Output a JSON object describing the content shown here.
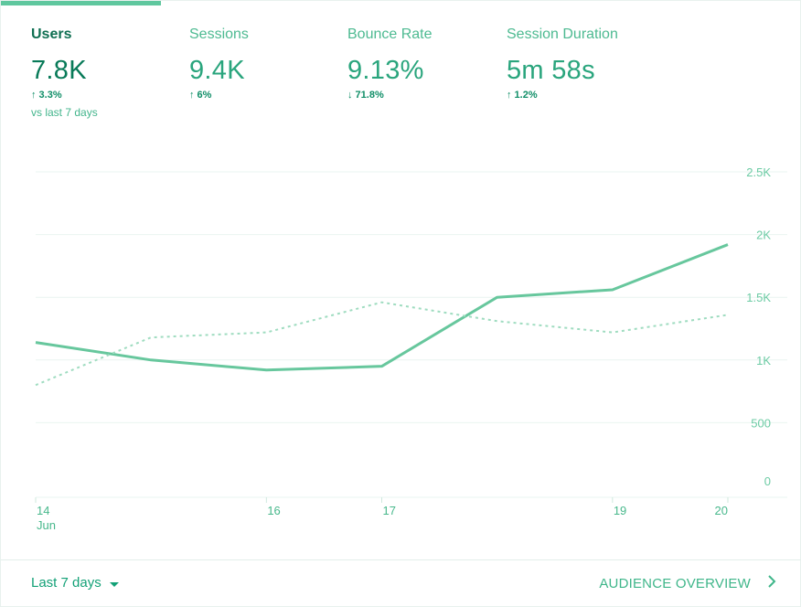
{
  "metrics": [
    {
      "label": "Users",
      "value": "7.8K",
      "change": "↑ 3.3%",
      "compare": "vs last 7 days",
      "active": true
    },
    {
      "label": "Sessions",
      "value": "9.4K",
      "change": "↑ 6%"
    },
    {
      "label": "Bounce Rate",
      "value": "9.13%",
      "change": "↓ 71.8%"
    },
    {
      "label": "Session Duration",
      "value": "5m 58s",
      "change": "↑ 1.2%"
    }
  ],
  "footer": {
    "range_label": "Last 7 days",
    "link_label": "AUDIENCE OVERVIEW"
  },
  "colors": {
    "accent": "#5fc79e",
    "line_primary": "#67c79d",
    "line_compare": "#9fdcc0",
    "grid": "#e9f4f0"
  },
  "chart_data": {
    "type": "line",
    "x": [
      "14",
      "15",
      "16",
      "17",
      "18",
      "19",
      "20"
    ],
    "x_tick_labels": [
      {
        "x": "14",
        "label": "14",
        "sublabel": "Jun"
      },
      {
        "x": "16",
        "label": "16"
      },
      {
        "x": "17",
        "label": "17"
      },
      {
        "x": "19",
        "label": "19"
      },
      {
        "x": "20",
        "label": "20"
      }
    ],
    "y_ticks": [
      "0",
      "500",
      "1K",
      "1.5K",
      "2K",
      "2.5K"
    ],
    "y_tick_values": [
      0,
      500,
      1000,
      1500,
      2000,
      2500
    ],
    "ylim": [
      0,
      2500
    ],
    "grid": true,
    "series": [
      {
        "style": "solid",
        "values": [
          1140,
          1000,
          920,
          950,
          1500,
          1560,
          1920
        ]
      },
      {
        "style": "dashed",
        "values": [
          800,
          1180,
          1220,
          1460,
          1310,
          1220,
          1360
        ]
      }
    ]
  }
}
